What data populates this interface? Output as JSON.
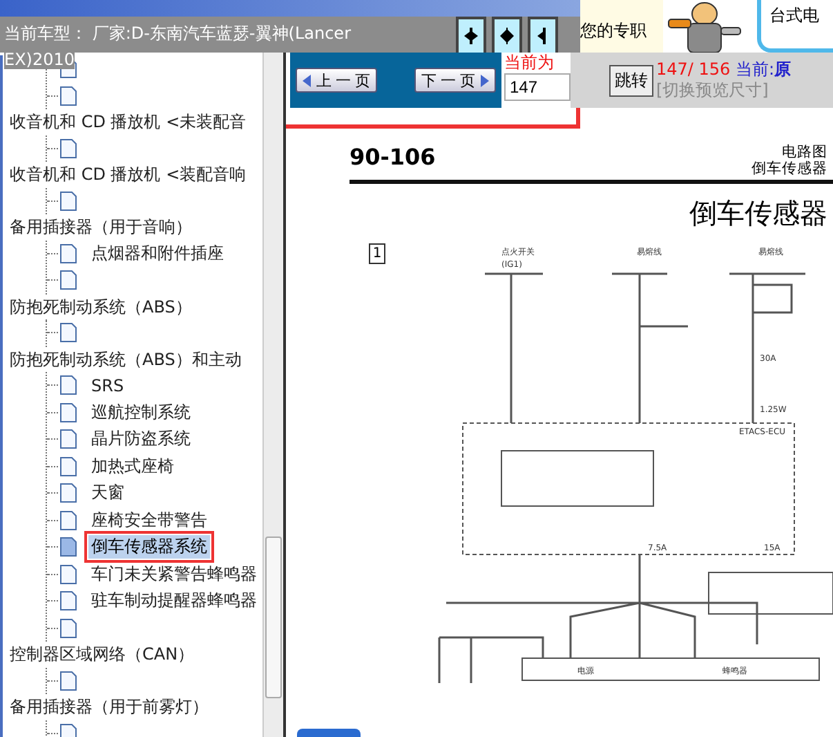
{
  "header": {
    "vehicle_info": "当前车型： 厂家:D-东南汽车蓝瑟-翼神(Lancer EX)2010",
    "nav_buttons": [
      {
        "kind": "right"
      },
      {
        "kind": "both"
      },
      {
        "kind": "left"
      }
    ],
    "promo_text": "您的专职",
    "ad_text": "台式电"
  },
  "tree": {
    "items": [
      {
        "children": [
          {
            "selected": false
          },
          {
            "selected": false
          }
        ]
      },
      {
        "label": "收音机和 CD 播放机 <未装配音",
        "children": [
          {
            "selected": false
          }
        ]
      },
      {
        "label": "收音机和 CD 播放机 <装配音响",
        "children": [
          {
            "selected": false
          }
        ]
      },
      {
        "label": "备用插接器（用于音响）",
        "children": [
          {
            "label": "点烟器和附件插座",
            "selected": false
          },
          {
            "selected": false
          }
        ]
      },
      {
        "label": "防抱死制动系统（ABS）",
        "children": [
          {
            "selected": false
          }
        ]
      },
      {
        "label": "防抱死制动系统（ABS）和主动",
        "children": [
          {
            "label": "SRS",
            "selected": false
          },
          {
            "label": "巡航控制系统",
            "selected": false
          },
          {
            "label": "晶片防盗系统",
            "selected": false
          },
          {
            "label": "加热式座椅",
            "selected": false
          },
          {
            "label": "天窗",
            "selected": false
          },
          {
            "label": "座椅安全带警告",
            "selected": false
          },
          {
            "label": "倒车传感器系统",
            "selected": true,
            "highlighted": true
          },
          {
            "label": "车门未关紧警告蜂鸣器",
            "selected": false
          },
          {
            "label": "驻车制动提醒器蜂鸣器",
            "selected": false
          },
          {
            "selected": false
          }
        ]
      },
      {
        "label": "控制器区域网络（CAN）",
        "children": [
          {
            "selected": false
          }
        ]
      },
      {
        "label": "备用插接器（用于前雾灯）",
        "children": [
          {
            "selected": false
          }
        ]
      }
    ]
  },
  "toolbar": {
    "highlighted": true,
    "prev_button": "上 一 页",
    "next_button": "下 一 页",
    "current_label": "当前为",
    "page_input": "147",
    "jump_button": "跳转",
    "page_count": "147/ 156",
    "mode_label": "当前:",
    "mode_value": "原",
    "resize_link": "[切换预览尺寸]"
  },
  "document": {
    "page_number": "90-106",
    "section": "电路图",
    "subtitle": "倒车传感器",
    "title": "倒车传感器",
    "figure_number": "1",
    "diagram_labels": [
      "点火开关",
      "(IG1)",
      "易熔线",
      "易熔线",
      "30A",
      "1.25W",
      "ETACS-ECU",
      "7.5A",
      "15A",
      "电源",
      "蜂鸣器"
    ]
  }
}
